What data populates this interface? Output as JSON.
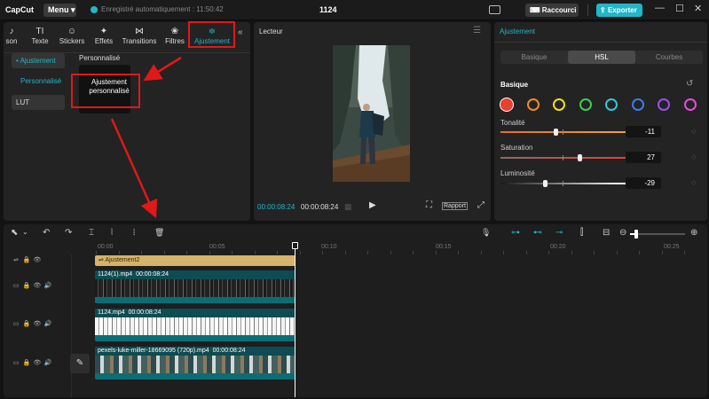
{
  "titlebar": {
    "logo": "CapCut",
    "menu_label": "Menu",
    "autosave_text": "Enregistré automatiquement : 11:50:42",
    "project_name": "1124",
    "shortcuts_label": "Raccourci",
    "export_label": "Exporter",
    "minimize": "—",
    "maximize": "☐",
    "close": "✕"
  },
  "left_panel": {
    "tabs": [
      {
        "label": "son",
        "icon": "♪"
      },
      {
        "label": "Texte",
        "icon": "TI"
      },
      {
        "label": "Stickers",
        "icon": "☺"
      },
      {
        "label": "Effets",
        "icon": "✦"
      },
      {
        "label": "Transitions",
        "icon": "⋈"
      },
      {
        "label": "Filtres",
        "icon": "❀"
      },
      {
        "label": "Ajustement",
        "icon": "≑"
      }
    ],
    "collapse_icon": "«",
    "side_items": [
      {
        "label": "• Ajustement"
      },
      {
        "label": "Personnalisé"
      },
      {
        "label": "LUT"
      }
    ],
    "section_title": "Personnalisé",
    "card_label_line1": "Ajustement",
    "card_label_line2": "personnalisé"
  },
  "player": {
    "title": "Lecteur",
    "menu_icon": "☰",
    "current_time": "00:00:08:24",
    "total_time": "00:00:08:24",
    "grid_icon": "▦",
    "play_icon": "▶",
    "scan_icon": "⛶",
    "ratio_label": "Rapport",
    "fullscreen_icon": "⤢"
  },
  "adjust_panel": {
    "title": "Ajustement",
    "tabs": [
      "Basique",
      "HSL",
      "Courbes"
    ],
    "active_tab": "HSL",
    "section": "Basique",
    "reset_icon": "↺",
    "swatches": [
      "#e8402f",
      "#f28c1e",
      "#f4e017",
      "#36d24f",
      "#2ec9d6",
      "#3c7bea",
      "#9d4ff0",
      "#e24ee0"
    ],
    "sliders": [
      {
        "label": "Tonalité",
        "value": "-11",
        "level": -11
      },
      {
        "label": "Saturation",
        "value": "27",
        "level": 27
      },
      {
        "label": "Luminosité",
        "value": "-29",
        "level": -29
      }
    ],
    "keyframe_icon": "◇"
  },
  "timeline": {
    "tools": {
      "select": "⬉",
      "select_caret": "⌄",
      "undo": "↶",
      "redo": "↷",
      "split": "⌶",
      "split_left": "⦚",
      "split_right": "⦙",
      "delete": "🗑",
      "mic": "🎙",
      "magnet": "⊶",
      "link": "⊷",
      "preview": "⊸",
      "align": "⫿",
      "caption": "⊟",
      "zoom_out": "⊖",
      "zoom_in": "⊕"
    },
    "ruler": [
      "00:00",
      "00:05",
      "00:10",
      "00:15",
      "00:20",
      "00:25"
    ],
    "adjust_clip_label": "Ajustement2",
    "clips": [
      {
        "name": "1124(1).mp4",
        "duration": "00:00:08:24"
      },
      {
        "name": "1124.mp4",
        "duration": "00:00:08:24"
      },
      {
        "name": "pexels-luke-miller-18669095 (720p).mp4",
        "duration": "00:00:08:24"
      }
    ],
    "track_icons": {
      "adjust": "⇌",
      "video": "▭",
      "lock": "🔒",
      "eye": "👁",
      "audio": "🔊"
    },
    "edit_icon": "✎"
  }
}
